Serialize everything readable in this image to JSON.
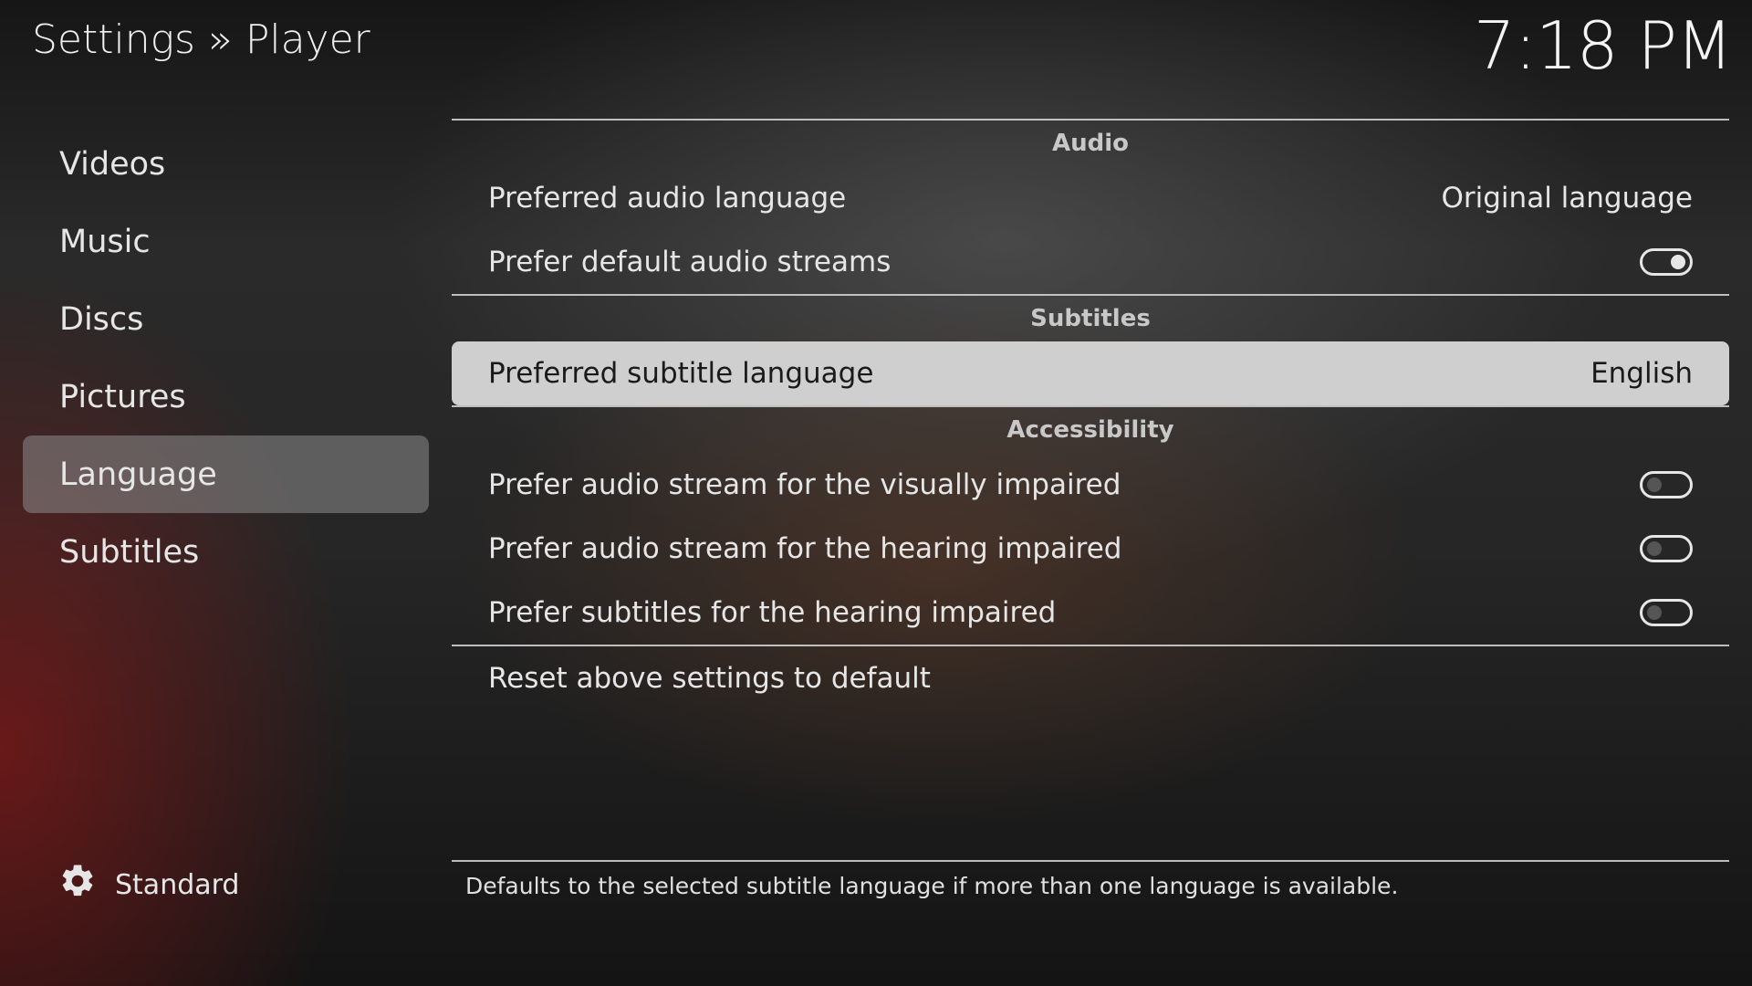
{
  "header": {
    "title": "Settings » Player",
    "clock": "7:18 PM"
  },
  "sidebar": {
    "items": [
      {
        "label": "Videos"
      },
      {
        "label": "Music"
      },
      {
        "label": "Discs"
      },
      {
        "label": "Pictures"
      },
      {
        "label": "Language",
        "selected": true
      },
      {
        "label": "Subtitles"
      }
    ],
    "level": {
      "icon": "gear-icon",
      "label": "Standard"
    }
  },
  "sections": {
    "audio": {
      "header": "Audio",
      "preferred_audio_language": {
        "label": "Preferred audio language",
        "value": "Original language"
      },
      "prefer_default_audio_streams": {
        "label": "Prefer default audio streams",
        "enabled": true
      }
    },
    "subtitles": {
      "header": "Subtitles",
      "preferred_subtitle_language": {
        "label": "Preferred subtitle language",
        "value": "English"
      }
    },
    "accessibility": {
      "header": "Accessibility",
      "visually_impaired": {
        "label": "Prefer audio stream for the visually impaired",
        "enabled": false
      },
      "hearing_impaired_audio": {
        "label": "Prefer audio stream for the hearing impaired",
        "enabled": false
      },
      "hearing_impaired_subtitles": {
        "label": "Prefer subtitles for the hearing impaired",
        "enabled": false
      }
    },
    "reset": {
      "label": "Reset above settings to default"
    }
  },
  "footer": {
    "description": "Defaults to the selected subtitle language if more than one language is available."
  },
  "colors": {
    "focused_row": "#cfcfcf",
    "selected_sidebar": "#8c8c8c"
  }
}
